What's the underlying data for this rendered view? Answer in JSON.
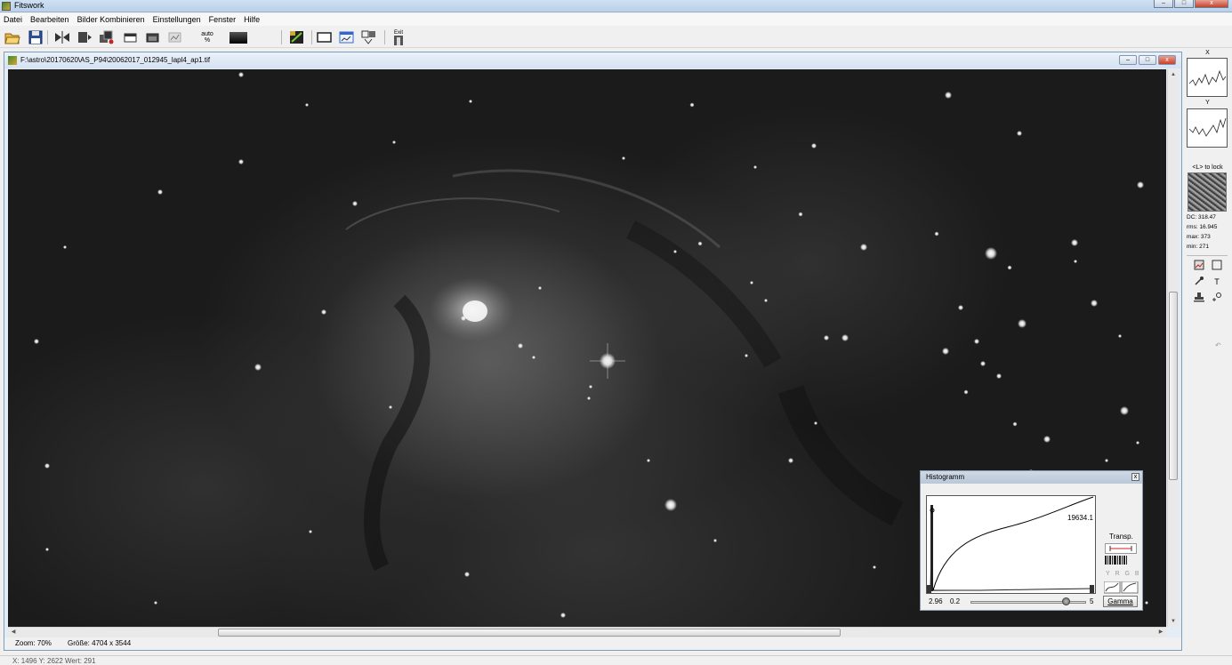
{
  "window": {
    "title": "Fitswork",
    "minimize": "–",
    "maximize": "□",
    "close": "x"
  },
  "menu": [
    "Datei",
    "Bearbeiten",
    "Bilder Kombinieren",
    "Einstellungen",
    "Fenster",
    "Hilfe"
  ],
  "toolbar": {
    "icons": [
      "open-folder-icon",
      "save-icon",
      "flip-horizontal-icon",
      "rotate-icon",
      "stack-icon",
      "window-a-icon",
      "window-b-icon",
      "filter-icon",
      "auto-level-icon",
      "gradient-icon",
      "color-balance-icon",
      "screen-icon",
      "chart-window-icon",
      "align-icon",
      "exit-icon"
    ],
    "auto_label": "auto",
    "auto_sub": "%",
    "exit_label": "Exit"
  },
  "document": {
    "path": "F:\\astro\\20170620\\AS_P94\\20062017_012945_lapl4_ap1.tif",
    "zoom": "Zoom: 70%",
    "size": "Größe: 4704 x 3544"
  },
  "histogram": {
    "title": "Histogramm",
    "max_value": "19634.1",
    "black_point": "2.96",
    "low": "0.2",
    "high": "5",
    "gamma_slider_fraction": 0.83,
    "transp_label": "Transp.",
    "channels": "Y R G B",
    "gamma_button": "Gamma"
  },
  "right_panel": {
    "x_label": "X",
    "y_label": "Y",
    "lock_hint": "<L> to lock",
    "dc": "DC: 318.47",
    "rms": "rms: 16.945",
    "max": "max: 373",
    "min": "min: 271",
    "tools": [
      "image-select-icon",
      "rectangle-icon",
      "pin-icon",
      "text-icon",
      "stamp-icon",
      "circle-icon"
    ],
    "text_tool": "T"
  },
  "status": {
    "cursor": "X: 1496  Y: 2622  Wert: 291"
  }
}
